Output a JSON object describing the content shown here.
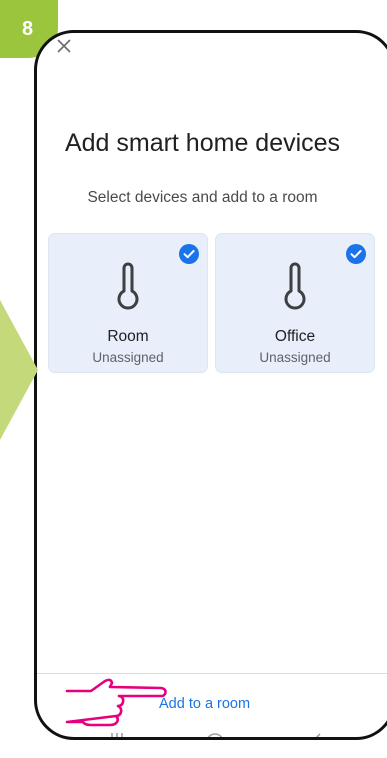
{
  "step": {
    "number": "8"
  },
  "screen": {
    "title": "Add smart home devices",
    "subtitle": "Select devices and add to a room"
  },
  "devices": [
    {
      "name": "Room",
      "status": "Unassigned",
      "selected": true,
      "icon": "thermometer-icon"
    },
    {
      "name": "Office",
      "status": "Unassigned",
      "selected": true,
      "icon": "thermometer-icon"
    }
  ],
  "footer": {
    "action_label": "Add to a room"
  },
  "colors": {
    "accent": "#1a73e8",
    "step_badge": "#9bc53d",
    "card_background": "#e8eefa",
    "pointer_annotation": "#e6007e"
  },
  "icons": {
    "close": "close-icon",
    "check": "check-circle-icon",
    "pointer": "hand-pointer-icon"
  }
}
